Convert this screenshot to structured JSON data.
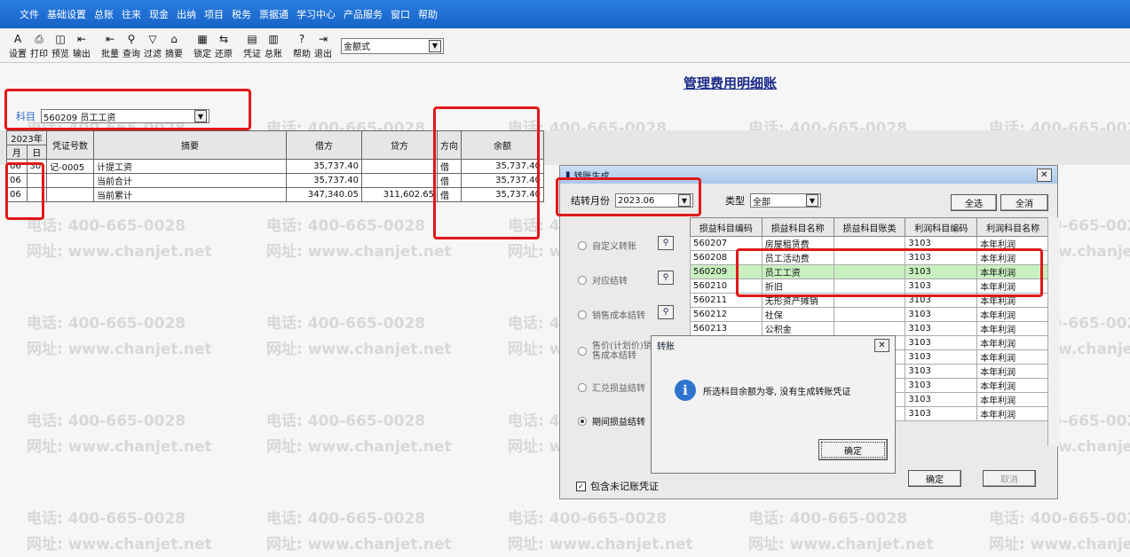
{
  "menu": [
    "文件",
    "基础设置",
    "总账",
    "往来",
    "现金",
    "出纳",
    "项目",
    "税务",
    "票据通",
    "学习中心",
    "产品服务",
    "窗口",
    "帮助"
  ],
  "toolbar": {
    "buttons": [
      {
        "icon": "settings-icon",
        "glyph": "A",
        "label": "设置"
      },
      {
        "icon": "print-icon",
        "glyph": "⎙",
        "label": "打印"
      },
      {
        "icon": "preview-icon",
        "glyph": "◫",
        "label": "预览"
      },
      {
        "icon": "export-icon",
        "glyph": "⇤",
        "label": "输出"
      },
      {
        "icon": "batch-icon",
        "glyph": "⇤",
        "label": "批量"
      },
      {
        "icon": "search-icon",
        "glyph": "⚲",
        "label": "查询"
      },
      {
        "icon": "filter-icon",
        "glyph": "▽",
        "label": "过滤"
      },
      {
        "icon": "summary-icon",
        "glyph": "⌂",
        "label": "摘要"
      },
      {
        "icon": "lock-icon",
        "glyph": "▦",
        "label": "锁定"
      },
      {
        "icon": "restore-icon",
        "glyph": "⇆",
        "label": "还原"
      },
      {
        "icon": "voucher-icon",
        "glyph": "▤",
        "label": "凭证"
      },
      {
        "icon": "ledger-icon",
        "glyph": "▥",
        "label": "总账"
      },
      {
        "icon": "help-icon",
        "glyph": "?",
        "label": "帮助"
      },
      {
        "icon": "exit-icon",
        "glyph": "⇥",
        "label": "退出"
      }
    ],
    "format_select": "金额式"
  },
  "report": {
    "title": "管理费用明细账",
    "subject_label": "科目",
    "subject_value": "560209 员工工资",
    "year_header": "2023年",
    "month_header": "月",
    "day_header": "日",
    "voucher_header": "凭证号数",
    "summary_header": "摘要",
    "debit_header": "借方",
    "credit_header": "贷方",
    "direction_header": "方向",
    "balance_header": "余额",
    "rows": [
      {
        "month": "06",
        "day": "30",
        "voucher": "记-0005",
        "summary": "计提工资",
        "debit": "35,737.40",
        "credit": "",
        "dir": "借",
        "balance": "35,737.40"
      },
      {
        "month": "06",
        "day": "",
        "voucher": "",
        "summary": "当前合计",
        "debit": "35,737.40",
        "credit": "",
        "dir": "借",
        "balance": "35,737.40"
      },
      {
        "month": "06",
        "day": "",
        "voucher": "",
        "summary": "当前累计",
        "debit": "347,340.05",
        "credit": "311,602.65",
        "dir": "借",
        "balance": "35,737.40"
      }
    ]
  },
  "watermark": {
    "phone": "电话: 400-665-0028",
    "site": "网址: www.chanjet.net"
  },
  "transfer_dialog": {
    "title": "转账生成",
    "month_label": "结转月份",
    "month_value": "2023.06",
    "type_label": "类型",
    "type_value": "全部",
    "select_all": "全选",
    "clear_all": "全消",
    "options": [
      {
        "label": "自定义转账",
        "checked": false
      },
      {
        "label": "对应结转",
        "checked": false
      },
      {
        "label": "销售成本结转",
        "checked": false
      },
      {
        "label": "售价(计划价)销售成本结转",
        "checked": false
      },
      {
        "label": "汇兑损益结转",
        "checked": false
      },
      {
        "label": "期间损益结转",
        "checked": true
      }
    ],
    "columns": [
      "损益科目编码",
      "损益科目名称",
      "损益科目账类",
      "利润科目编码",
      "利润科目名称"
    ],
    "rows": [
      {
        "code": "560207",
        "name": "房屋租赁费",
        "cls": "",
        "pcode": "3103",
        "pname": "本年利润"
      },
      {
        "code": "560208",
        "name": "员工活动费",
        "cls": "",
        "pcode": "3103",
        "pname": "本年利润"
      },
      {
        "code": "560209",
        "name": "员工工资",
        "cls": "",
        "pcode": "3103",
        "pname": "本年利润",
        "hl": true
      },
      {
        "code": "560210",
        "name": "折旧",
        "cls": "",
        "pcode": "3103",
        "pname": "本年利润"
      },
      {
        "code": "560211",
        "name": "无形资产摊销",
        "cls": "",
        "pcode": "3103",
        "pname": "本年利润"
      },
      {
        "code": "560212",
        "name": "社保",
        "cls": "",
        "pcode": "3103",
        "pname": "本年利润"
      },
      {
        "code": "560213",
        "name": "公积金",
        "cls": "",
        "pcode": "3103",
        "pname": "本年利润"
      },
      {
        "code": "",
        "name": "",
        "cls": "",
        "pcode": "3103",
        "pname": "本年利润"
      },
      {
        "code": "",
        "name": "",
        "cls": "",
        "pcode": "3103",
        "pname": "本年利润"
      },
      {
        "code": "",
        "name": "",
        "cls": "",
        "pcode": "3103",
        "pname": "本年利润"
      },
      {
        "code": "",
        "name": "",
        "cls": "",
        "pcode": "3103",
        "pname": "本年利润"
      },
      {
        "code": "",
        "name": "",
        "cls": "",
        "pcode": "3103",
        "pname": "本年利润"
      },
      {
        "code": "",
        "name": "",
        "cls": "",
        "pcode": "3103",
        "pname": "本年利润"
      }
    ],
    "include_unposted": "包含未记账凭证",
    "ok": "确定",
    "cancel": "取消"
  },
  "message_box": {
    "title": "转账",
    "message": "所选科目余额为零, 没有生成转账凭证",
    "ok": "确定"
  },
  "colors": {
    "highlight": "#e01818",
    "menubar": "#1f6fd6",
    "row_highlight": "#c8f0c0"
  }
}
